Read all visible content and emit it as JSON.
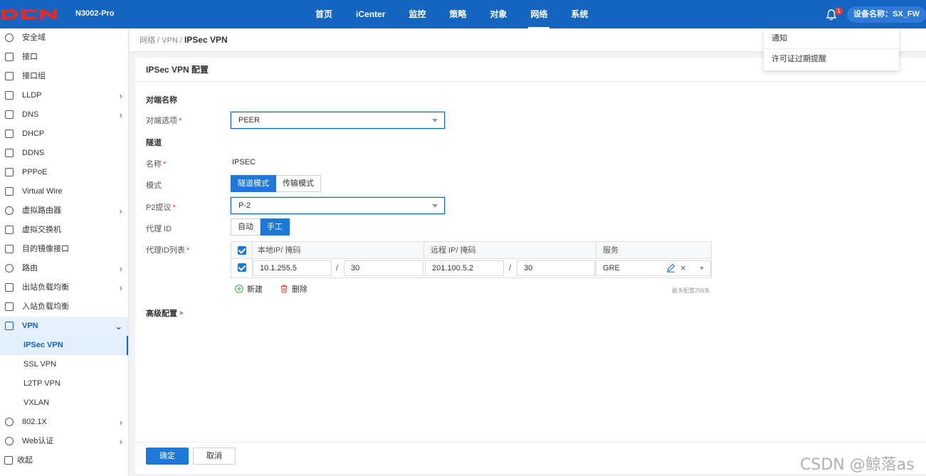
{
  "header": {
    "logo_text": "DCN",
    "model": "N3002-Pro",
    "nav": [
      {
        "label": "首页"
      },
      {
        "label": "iCenter"
      },
      {
        "label": "监控"
      },
      {
        "label": "策略"
      },
      {
        "label": "对象"
      },
      {
        "label": "网络",
        "active": true
      },
      {
        "label": "系统"
      }
    ],
    "notification_count": "1",
    "device_label": "设备名称：SX_FW"
  },
  "notifications": {
    "items": [
      "通知",
      "许可证过期提醒"
    ]
  },
  "sidebar": {
    "items": [
      {
        "label": "安全域",
        "icon": "target-icon"
      },
      {
        "label": "接口",
        "icon": "interface-icon"
      },
      {
        "label": "接口组",
        "icon": "interface-group-icon"
      },
      {
        "label": "LLDP",
        "icon": "lldp-icon",
        "chevron": "›"
      },
      {
        "label": "DNS",
        "icon": "dns-icon",
        "chevron": "›"
      },
      {
        "label": "DHCP",
        "icon": "dhcp-icon"
      },
      {
        "label": "DDNS",
        "icon": "ddns-icon"
      },
      {
        "label": "PPPoE",
        "icon": "pppoe-icon"
      },
      {
        "label": "Virtual Wire",
        "icon": "virtual-wire-icon"
      },
      {
        "label": "虚拟路由器",
        "icon": "virtual-router-icon",
        "chevron": "›"
      },
      {
        "label": "虚拟交换机",
        "icon": "virtual-switch-icon"
      },
      {
        "label": "目的镜像接口",
        "icon": "mirror-icon"
      },
      {
        "label": "路由",
        "icon": "route-icon",
        "chevron": "›"
      },
      {
        "label": "出站负载均衡",
        "icon": "outbound-lb-icon",
        "chevron": "›"
      },
      {
        "label": "入站负载均衡",
        "icon": "inbound-lb-icon"
      },
      {
        "label": "VPN",
        "icon": "vpn-icon",
        "chevron": "⌄",
        "open": true
      },
      {
        "label": "IPSec VPN",
        "sub": true,
        "active": true
      },
      {
        "label": "SSL VPN",
        "sub": true
      },
      {
        "label": "L2TP VPN",
        "sub": true
      },
      {
        "label": "VXLAN",
        "sub": true
      },
      {
        "label": "802.1X",
        "icon": "wifi-icon",
        "chevron": "›"
      },
      {
        "label": "Web认证",
        "icon": "web-auth-icon",
        "chevron": "›"
      }
    ],
    "collapse_label": "收起"
  },
  "breadcrumb": {
    "path": "网络 / VPN / ",
    "current": "IPSec VPN"
  },
  "panel": {
    "title": "IPSec VPN 配置",
    "peer_section": "对端名称",
    "peer_option_label": "对端选项",
    "peer_option_value": "PEER",
    "tunnel_section": "隧道",
    "name_label": "名称",
    "name_value": "IPSEC",
    "mode_label": "模式",
    "mode_options": [
      "隧道模式",
      "传输模式"
    ],
    "p2_label": "P2提议",
    "p2_value": "P-2",
    "proxy_id_label": "代理 ID",
    "proxy_id_options": [
      "自动",
      "手工"
    ],
    "proxy_list_label": "代理ID列表",
    "table": {
      "headers": [
        "本地IP/ 掩码",
        "远程 IP/ 掩码",
        "服务"
      ],
      "rows": [
        {
          "local_ip": "10.1.255.5",
          "local_mask": "30",
          "remote_ip": "201.100.5.2",
          "remote_mask": "30",
          "service": "GRE"
        }
      ],
      "slash": "/"
    },
    "add_label": "新建",
    "delete_label": "删除",
    "max_note": "最多配置256条",
    "advanced_label": "高级配置",
    "confirm_label": "确定",
    "cancel_label": "取消"
  },
  "watermark": "CSDN @鲸落as",
  "colors": {
    "brand": "#1565c0",
    "accent": "#1e78d7",
    "danger": "#e53935"
  }
}
